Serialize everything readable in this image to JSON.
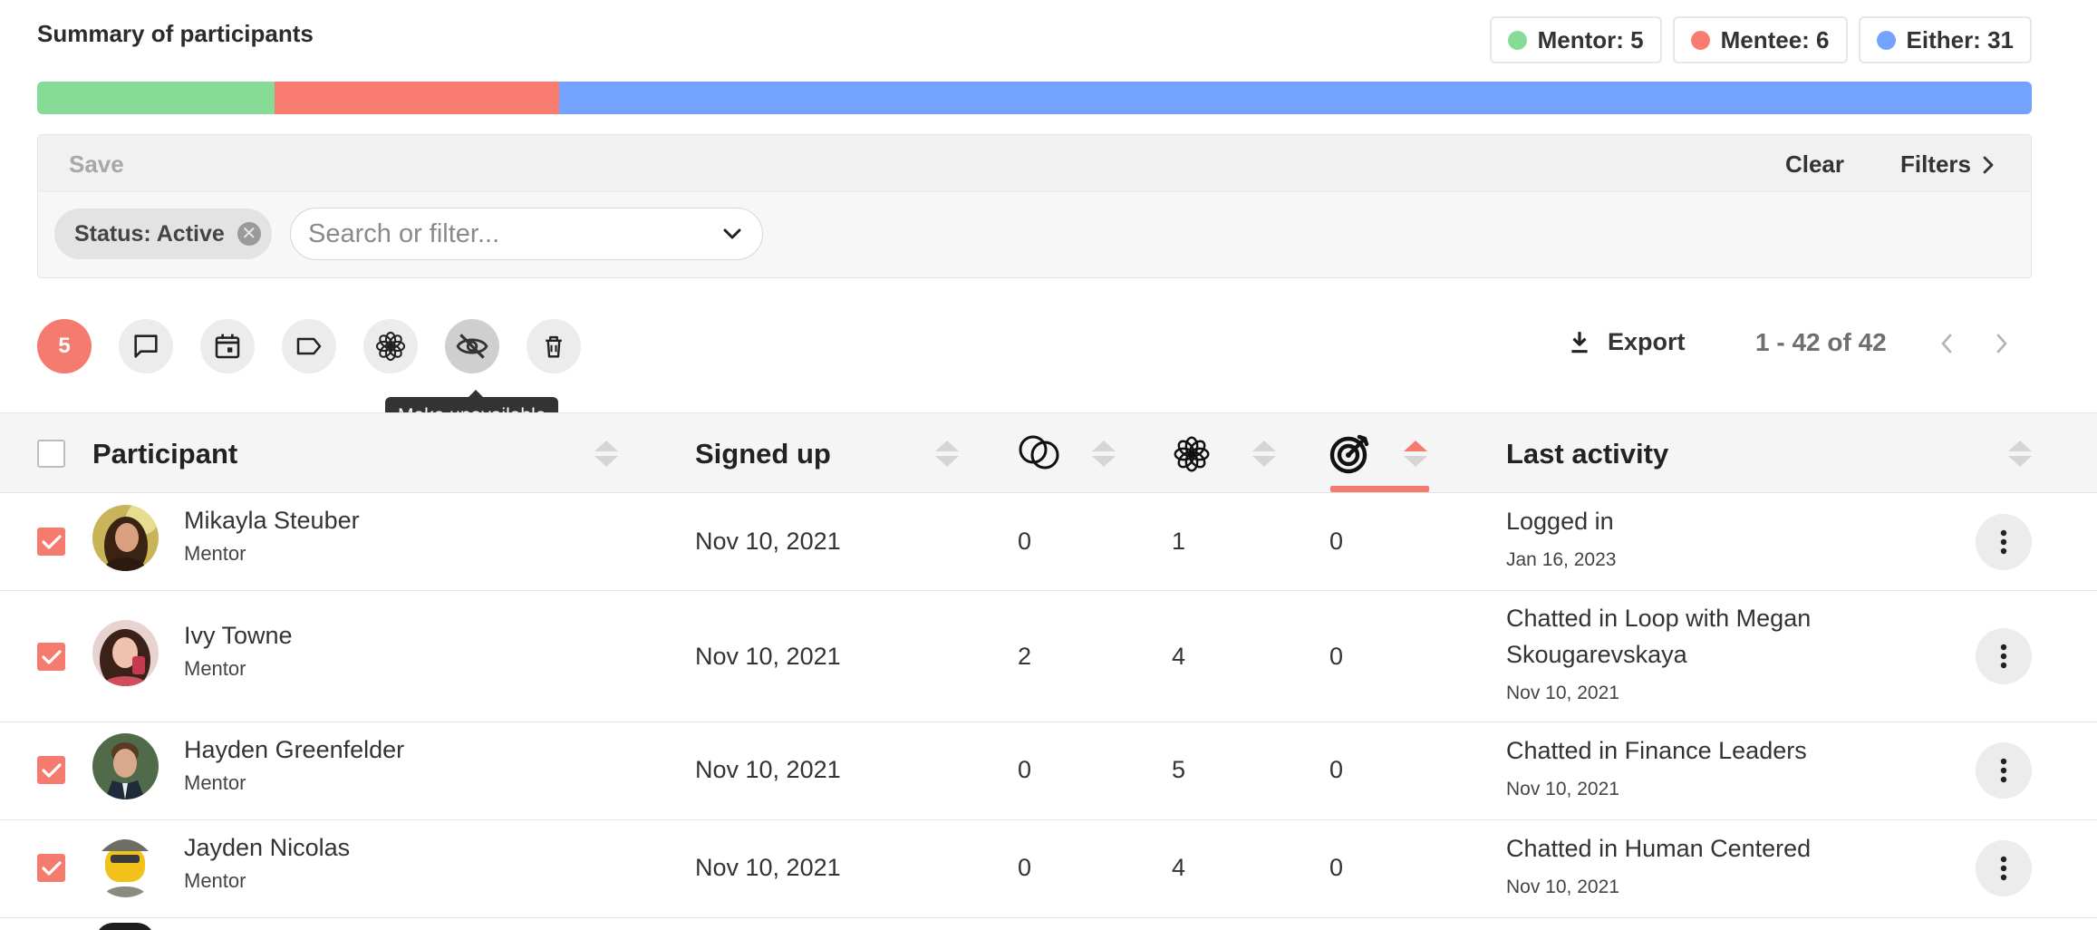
{
  "summary": {
    "title": "Summary of participants",
    "legend": [
      {
        "label": "Mentor: 5",
        "color": "#86dc97"
      },
      {
        "label": "Mentee: 6",
        "color": "#f87c6f"
      },
      {
        "label": "Either: 31",
        "color": "#73a3ff"
      }
    ],
    "distribution": [
      {
        "name": "Mentor",
        "count": 5,
        "color": "#86dc97"
      },
      {
        "name": "Mentee",
        "count": 6,
        "color": "#f87c6f"
      },
      {
        "name": "Either",
        "count": 31,
        "color": "#73a3ff"
      }
    ]
  },
  "filters": {
    "save_label": "Save",
    "clear_label": "Clear",
    "filters_label": "Filters",
    "active_chip": "Status: Active",
    "search_placeholder": "Search or filter..."
  },
  "toolbar": {
    "selected_count": "5",
    "icons": [
      "chat-icon",
      "calendar-icon",
      "tag-icon",
      "flower-icon",
      "eye-off-icon",
      "trash-icon"
    ],
    "tooltip": "Make unavailable",
    "export_label": "Export",
    "pagination": "1 - 42 of 42"
  },
  "table": {
    "headers": {
      "participant": "Participant",
      "signed_up": "Signed up",
      "last_activity": "Last activity"
    },
    "column_icons": [
      "loops-icon",
      "flower-icon",
      "target-icon"
    ],
    "rows": [
      {
        "name": "Mikayla Steuber",
        "role": "Mentor",
        "signed_up": "Nov 10, 2021",
        "loops": "0",
        "groups": "1",
        "goals": "0",
        "activity": "Logged in",
        "activity_date": "Jan 16, 2023",
        "checked": true
      },
      {
        "name": "Ivy Towne",
        "role": "Mentor",
        "signed_up": "Nov 10, 2021",
        "loops": "2",
        "groups": "4",
        "goals": "0",
        "activity": "Chatted in Loop with Megan Skougarevskaya",
        "activity_date": "Nov 10, 2021",
        "checked": true
      },
      {
        "name": "Hayden Greenfelder",
        "role": "Mentor",
        "signed_up": "Nov 10, 2021",
        "loops": "0",
        "groups": "5",
        "goals": "0",
        "activity": "Chatted in Finance Leaders",
        "activity_date": "Nov 10, 2021",
        "checked": true
      },
      {
        "name": "Jayden Nicolas",
        "role": "Mentor",
        "signed_up": "Nov 10, 2021",
        "loops": "0",
        "groups": "4",
        "goals": "0",
        "activity": "Chatted in Human Centered",
        "activity_date": "Nov 10, 2021",
        "checked": true
      }
    ]
  }
}
